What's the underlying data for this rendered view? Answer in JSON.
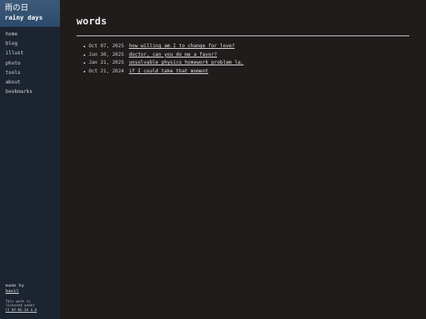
{
  "brand": {
    "title_jp": "雨の日",
    "title_en": "rainy days"
  },
  "nav": {
    "items": [
      {
        "label": "home"
      },
      {
        "label": "blog"
      },
      {
        "label": "illust"
      },
      {
        "label": "photo"
      },
      {
        "label": "tools"
      },
      {
        "label": "about"
      },
      {
        "label": "bookmarks"
      }
    ]
  },
  "footer": {
    "made_by": "made by",
    "author": "basil",
    "license_text_1": "This work is",
    "license_text_2": "licensed under",
    "license_link": "CC BY-NC-SA 4.0"
  },
  "main": {
    "title": "words",
    "posts": [
      {
        "date": "Oct 07, 2025",
        "title": "how willing am I to change for love?"
      },
      {
        "date": "Jun 30, 2025",
        "title": "doctor, can you do me a favor?"
      },
      {
        "date": "Jan 21, 2025",
        "title": "unsolvable physics homework problem la."
      },
      {
        "date": "Oct 21, 2024",
        "title": "if I could take that moment"
      }
    ]
  },
  "colors": {
    "page_background": "#1f1c1b",
    "sidebar_background": "#1c2430",
    "brand_background": "#2c4a6b",
    "text": "#d8d8d8"
  }
}
